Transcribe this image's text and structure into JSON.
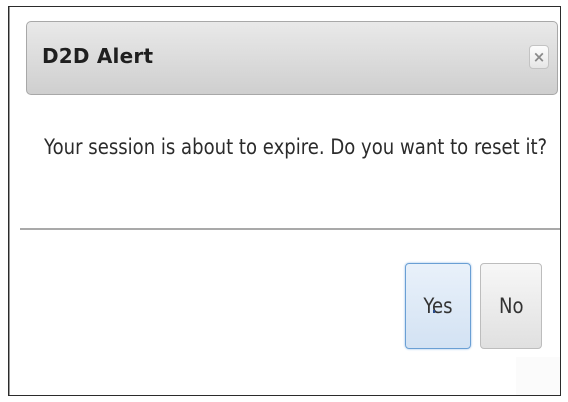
{
  "dialog": {
    "title": "D2D Alert",
    "close_label": "×",
    "message": "Your session is about to expire. Do you want to reset it?",
    "buttons": {
      "yes": "Yes",
      "no": "No"
    }
  },
  "colors": {
    "title_bar": "#d6d6d6",
    "focus_border": "#6a9fd4",
    "text": "#2b2b2b"
  },
  "icons": {
    "close": "close-icon"
  }
}
